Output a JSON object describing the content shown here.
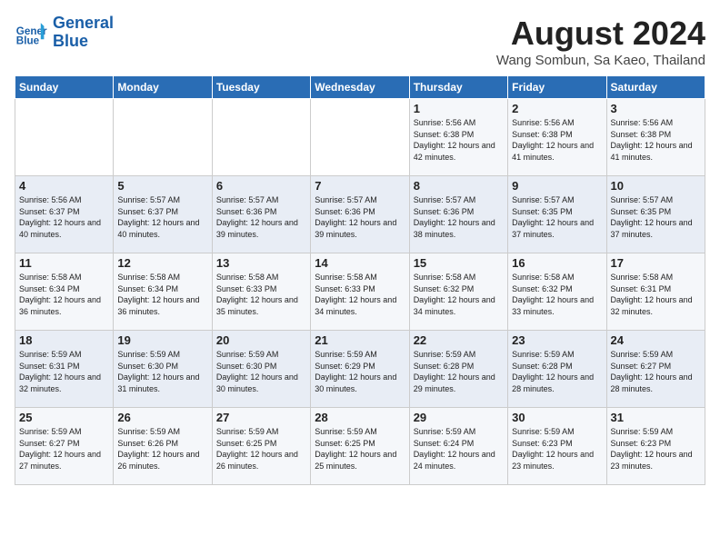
{
  "header": {
    "logo_line1": "General",
    "logo_line2": "Blue",
    "title": "August 2024",
    "subtitle": "Wang Sombun, Sa Kaeo, Thailand"
  },
  "weekdays": [
    "Sunday",
    "Monday",
    "Tuesday",
    "Wednesday",
    "Thursday",
    "Friday",
    "Saturday"
  ],
  "weeks": [
    [
      {
        "day": "",
        "info": ""
      },
      {
        "day": "",
        "info": ""
      },
      {
        "day": "",
        "info": ""
      },
      {
        "day": "",
        "info": ""
      },
      {
        "day": "1",
        "info": "Sunrise: 5:56 AM\nSunset: 6:38 PM\nDaylight: 12 hours\nand 42 minutes."
      },
      {
        "day": "2",
        "info": "Sunrise: 5:56 AM\nSunset: 6:38 PM\nDaylight: 12 hours\nand 41 minutes."
      },
      {
        "day": "3",
        "info": "Sunrise: 5:56 AM\nSunset: 6:38 PM\nDaylight: 12 hours\nand 41 minutes."
      }
    ],
    [
      {
        "day": "4",
        "info": "Sunrise: 5:56 AM\nSunset: 6:37 PM\nDaylight: 12 hours\nand 40 minutes."
      },
      {
        "day": "5",
        "info": "Sunrise: 5:57 AM\nSunset: 6:37 PM\nDaylight: 12 hours\nand 40 minutes."
      },
      {
        "day": "6",
        "info": "Sunrise: 5:57 AM\nSunset: 6:36 PM\nDaylight: 12 hours\nand 39 minutes."
      },
      {
        "day": "7",
        "info": "Sunrise: 5:57 AM\nSunset: 6:36 PM\nDaylight: 12 hours\nand 39 minutes."
      },
      {
        "day": "8",
        "info": "Sunrise: 5:57 AM\nSunset: 6:36 PM\nDaylight: 12 hours\nand 38 minutes."
      },
      {
        "day": "9",
        "info": "Sunrise: 5:57 AM\nSunset: 6:35 PM\nDaylight: 12 hours\nand 37 minutes."
      },
      {
        "day": "10",
        "info": "Sunrise: 5:57 AM\nSunset: 6:35 PM\nDaylight: 12 hours\nand 37 minutes."
      }
    ],
    [
      {
        "day": "11",
        "info": "Sunrise: 5:58 AM\nSunset: 6:34 PM\nDaylight: 12 hours\nand 36 minutes."
      },
      {
        "day": "12",
        "info": "Sunrise: 5:58 AM\nSunset: 6:34 PM\nDaylight: 12 hours\nand 36 minutes."
      },
      {
        "day": "13",
        "info": "Sunrise: 5:58 AM\nSunset: 6:33 PM\nDaylight: 12 hours\nand 35 minutes."
      },
      {
        "day": "14",
        "info": "Sunrise: 5:58 AM\nSunset: 6:33 PM\nDaylight: 12 hours\nand 34 minutes."
      },
      {
        "day": "15",
        "info": "Sunrise: 5:58 AM\nSunset: 6:32 PM\nDaylight: 12 hours\nand 34 minutes."
      },
      {
        "day": "16",
        "info": "Sunrise: 5:58 AM\nSunset: 6:32 PM\nDaylight: 12 hours\nand 33 minutes."
      },
      {
        "day": "17",
        "info": "Sunrise: 5:58 AM\nSunset: 6:31 PM\nDaylight: 12 hours\nand 32 minutes."
      }
    ],
    [
      {
        "day": "18",
        "info": "Sunrise: 5:59 AM\nSunset: 6:31 PM\nDaylight: 12 hours\nand 32 minutes."
      },
      {
        "day": "19",
        "info": "Sunrise: 5:59 AM\nSunset: 6:30 PM\nDaylight: 12 hours\nand 31 minutes."
      },
      {
        "day": "20",
        "info": "Sunrise: 5:59 AM\nSunset: 6:30 PM\nDaylight: 12 hours\nand 30 minutes."
      },
      {
        "day": "21",
        "info": "Sunrise: 5:59 AM\nSunset: 6:29 PM\nDaylight: 12 hours\nand 30 minutes."
      },
      {
        "day": "22",
        "info": "Sunrise: 5:59 AM\nSunset: 6:28 PM\nDaylight: 12 hours\nand 29 minutes."
      },
      {
        "day": "23",
        "info": "Sunrise: 5:59 AM\nSunset: 6:28 PM\nDaylight: 12 hours\nand 28 minutes."
      },
      {
        "day": "24",
        "info": "Sunrise: 5:59 AM\nSunset: 6:27 PM\nDaylight: 12 hours\nand 28 minutes."
      }
    ],
    [
      {
        "day": "25",
        "info": "Sunrise: 5:59 AM\nSunset: 6:27 PM\nDaylight: 12 hours\nand 27 minutes."
      },
      {
        "day": "26",
        "info": "Sunrise: 5:59 AM\nSunset: 6:26 PM\nDaylight: 12 hours\nand 26 minutes."
      },
      {
        "day": "27",
        "info": "Sunrise: 5:59 AM\nSunset: 6:25 PM\nDaylight: 12 hours\nand 26 minutes."
      },
      {
        "day": "28",
        "info": "Sunrise: 5:59 AM\nSunset: 6:25 PM\nDaylight: 12 hours\nand 25 minutes."
      },
      {
        "day": "29",
        "info": "Sunrise: 5:59 AM\nSunset: 6:24 PM\nDaylight: 12 hours\nand 24 minutes."
      },
      {
        "day": "30",
        "info": "Sunrise: 5:59 AM\nSunset: 6:23 PM\nDaylight: 12 hours\nand 23 minutes."
      },
      {
        "day": "31",
        "info": "Sunrise: 5:59 AM\nSunset: 6:23 PM\nDaylight: 12 hours\nand 23 minutes."
      }
    ]
  ]
}
